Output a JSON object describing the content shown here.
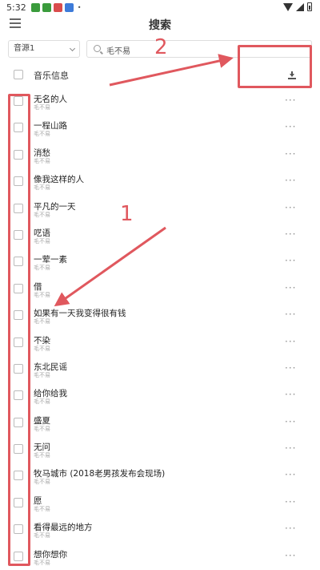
{
  "status_bar": {
    "time": "5:32",
    "app_icons": [
      {
        "name": "green-app-icon",
        "color": "#3a9b3c"
      },
      {
        "name": "green-app-icon",
        "color": "#3a9b3c"
      },
      {
        "name": "red-app-icon",
        "color": "#d94c4c"
      },
      {
        "name": "blue-app-icon",
        "color": "#3d7bd9"
      }
    ],
    "dot": "•"
  },
  "appbar": {
    "title": "搜索",
    "menu_icon": "hamburger-menu-icon"
  },
  "toolbar": {
    "source_select_value": "音源1",
    "search_value": "毛不易"
  },
  "header": {
    "label": "音乐信息",
    "download_icon": "download-icon"
  },
  "songs": [
    {
      "title": "无名的人",
      "artist": "毛不易"
    },
    {
      "title": "一程山路",
      "artist": "毛不易"
    },
    {
      "title": "消愁",
      "artist": "毛不易"
    },
    {
      "title": "像我这样的人",
      "artist": "毛不易"
    },
    {
      "title": "平凡的一天",
      "artist": "毛不易"
    },
    {
      "title": "呓语",
      "artist": "毛不易"
    },
    {
      "title": "一荤一素",
      "artist": "毛不易"
    },
    {
      "title": "借",
      "artist": "毛不易"
    },
    {
      "title": "如果有一天我变得很有钱",
      "artist": "毛不易"
    },
    {
      "title": "不染",
      "artist": "毛不易"
    },
    {
      "title": "东北民谣",
      "artist": "毛不易"
    },
    {
      "title": "给你给我",
      "artist": "毛不易"
    },
    {
      "title": "盛夏",
      "artist": "毛不易"
    },
    {
      "title": "无问",
      "artist": "毛不易"
    },
    {
      "title": "牧马城市 (2018老男孩发布会现场)",
      "artist": "毛不易"
    },
    {
      "title": "愿",
      "artist": "毛不易"
    },
    {
      "title": "看得最远的地方",
      "artist": "毛不易"
    },
    {
      "title": "想你想你",
      "artist": "毛不易"
    }
  ],
  "more_label": "···",
  "annotations": {
    "label_1": "1",
    "label_2": "2",
    "color": "#e0585e"
  }
}
